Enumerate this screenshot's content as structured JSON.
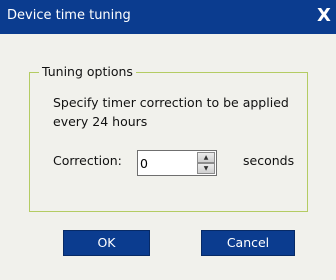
{
  "window": {
    "title": "Device time tuning",
    "close_glyph": "X"
  },
  "group": {
    "legend": "Tuning options",
    "description": "Specify timer correction to be applied every 24 hours"
  },
  "correction": {
    "label": "Correction:",
    "value": "0",
    "unit": "seconds",
    "up_glyph": "▲",
    "down_glyph": "▼"
  },
  "buttons": {
    "ok": "OK",
    "cancel": "Cancel"
  },
  "colors": {
    "titlebar": "#0b3c8f",
    "group_border": "#b4cc63",
    "window_bg": "#f1f1ec"
  }
}
